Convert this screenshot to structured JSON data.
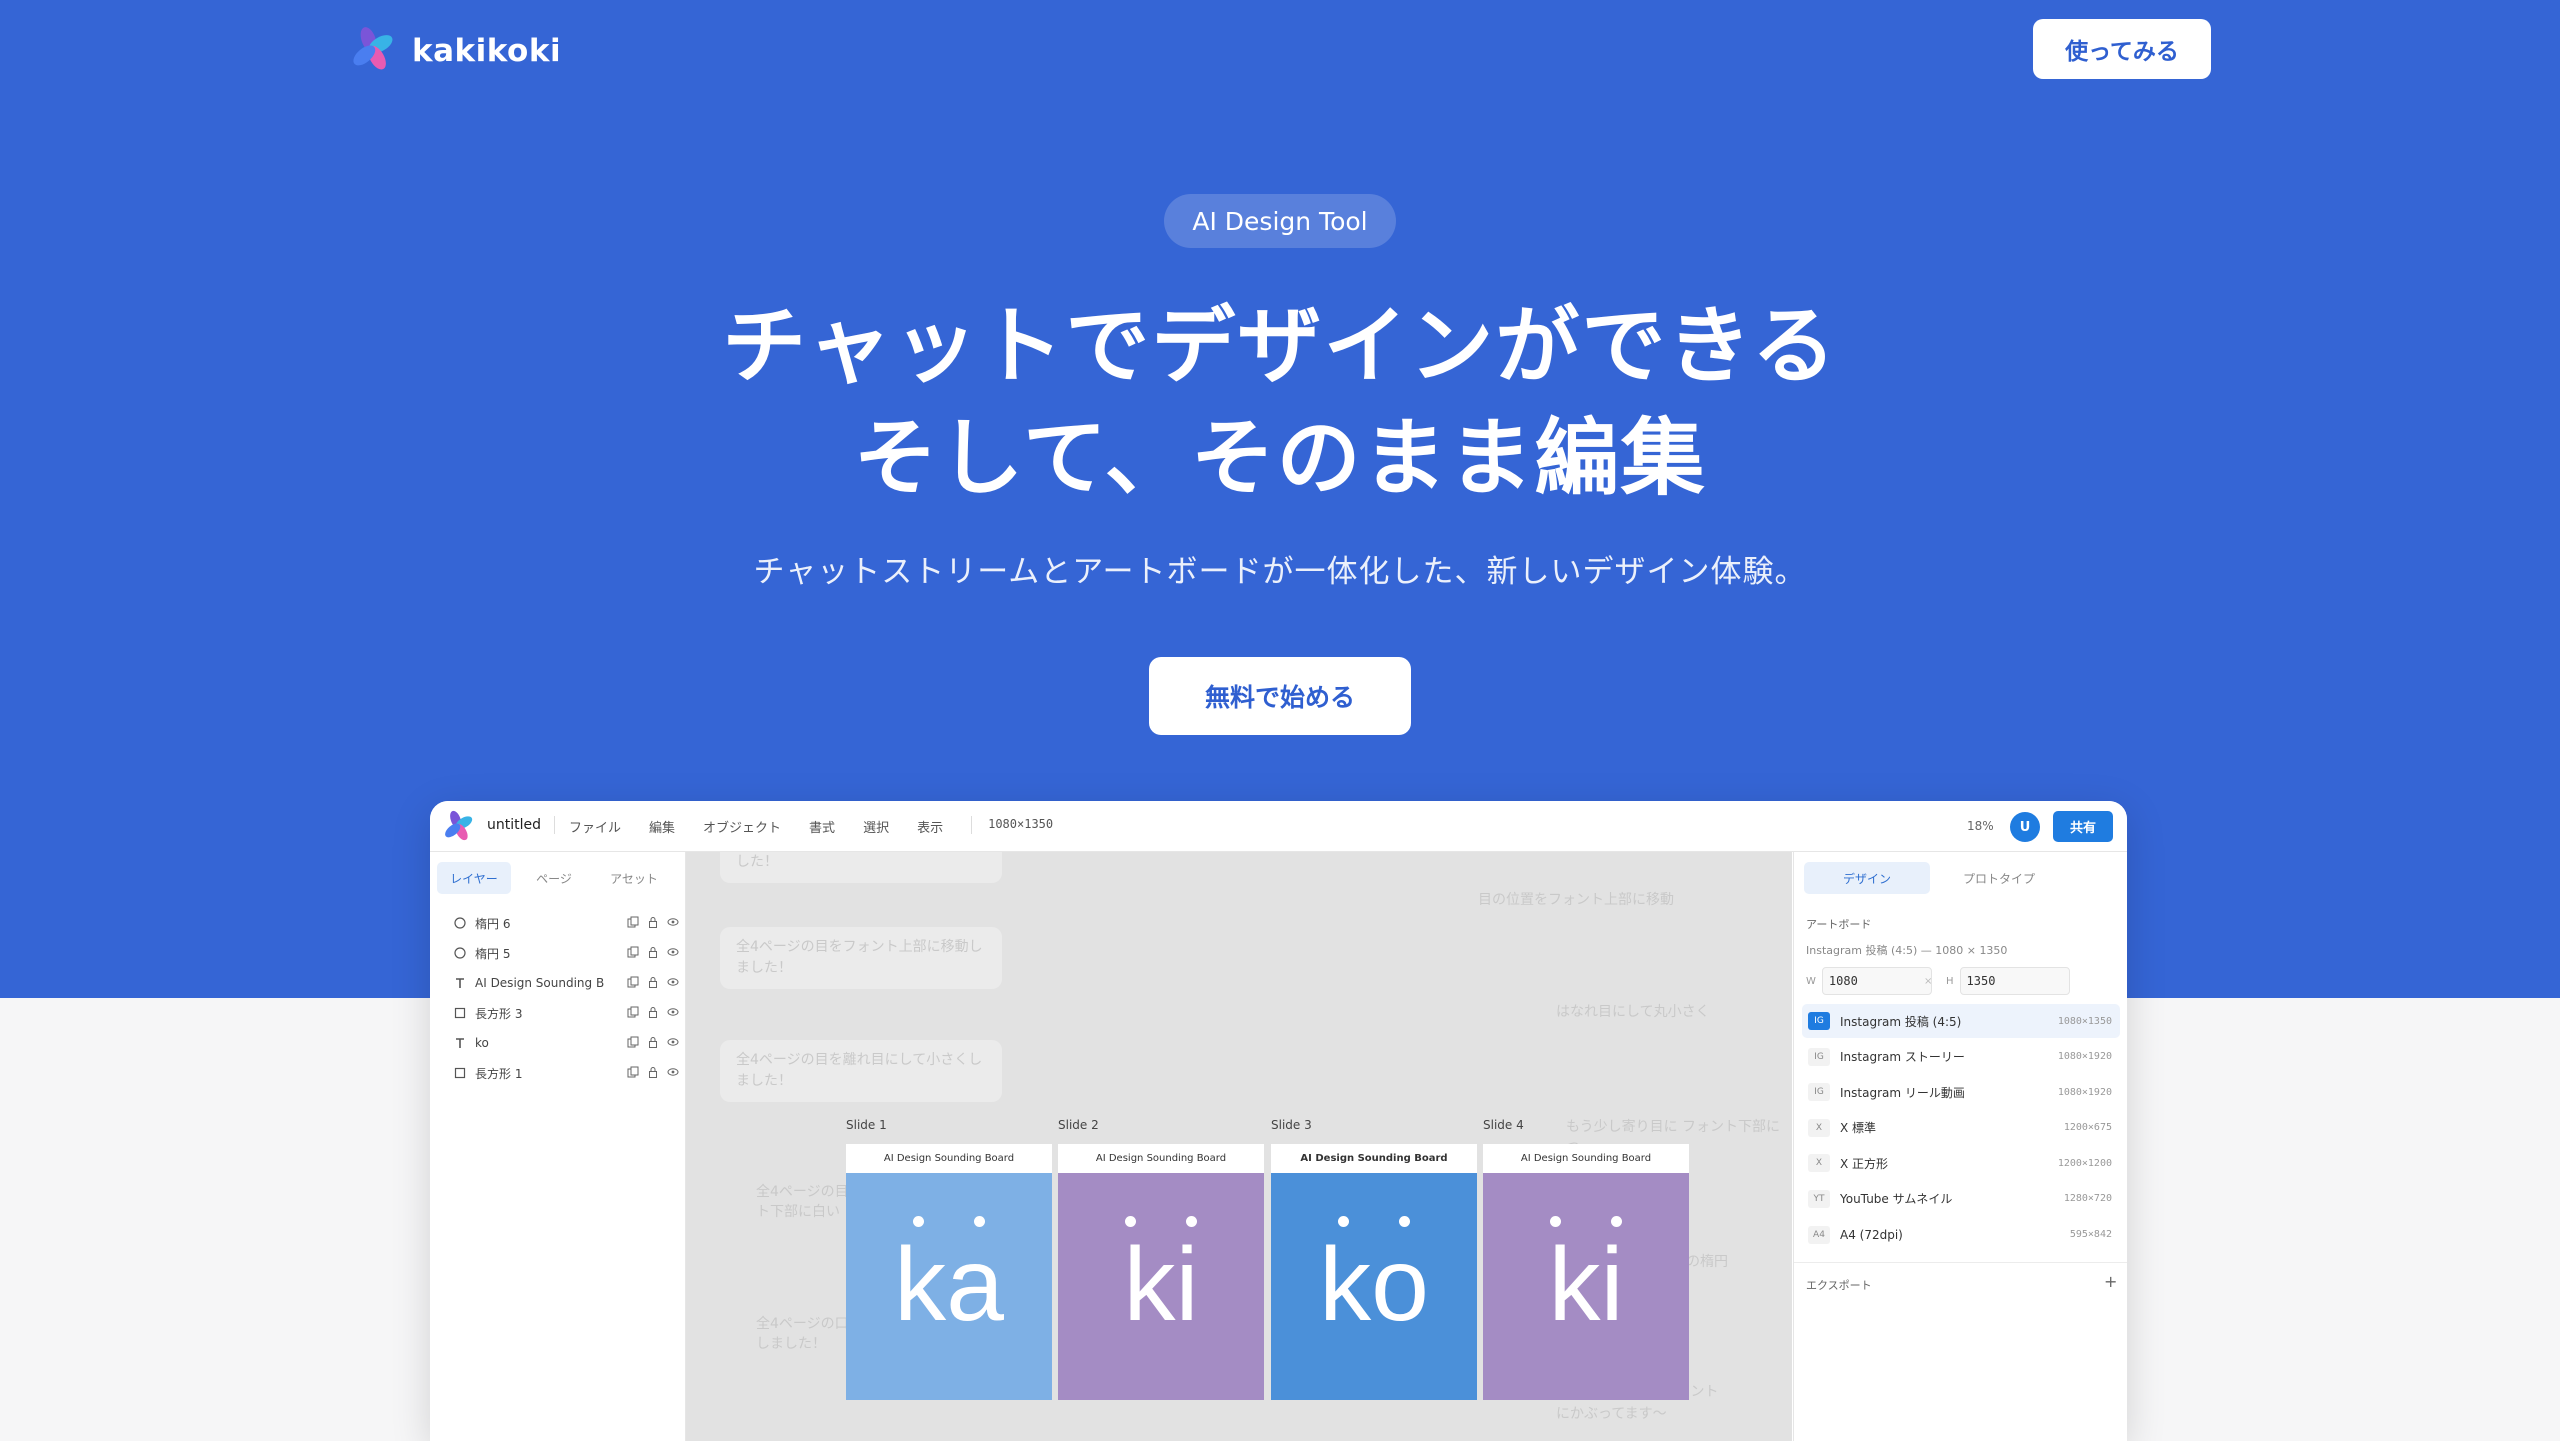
{
  "brand": {
    "name": "kakikoki"
  },
  "nav": {
    "cta": "使ってみる"
  },
  "hero": {
    "badge": "AI Design Tool",
    "headline_line1": "チャットでデザインができる",
    "headline_line2": "そして、そのまま編集",
    "subline": "チャットストリームとアートボードが一体化した、新しいデザイン体験。",
    "cta": "無料で始める"
  },
  "colors": {
    "hero_bg": "#3565d5",
    "accent": "#1f7ce0",
    "slide_light_blue": "#7eb0e5",
    "slide_purple": "#a48cc4",
    "slide_blue": "#4b90d9"
  },
  "app": {
    "doc_title": "untitled",
    "menu": [
      "ファイル",
      "編集",
      "オブジェクト",
      "書式",
      "選択",
      "表示"
    ],
    "dimensions": "1080×1350",
    "zoom": "18%",
    "avatar": "U",
    "share": "共有",
    "left_tabs": [
      "レイヤー",
      "ページ",
      "アセット"
    ],
    "layers": [
      {
        "icon": "ellipse-icon",
        "name": "楕円 6"
      },
      {
        "icon": "ellipse-icon",
        "name": "楕円 5"
      },
      {
        "icon": "text-icon",
        "name": "AI Design Sounding B"
      },
      {
        "icon": "rectangle-icon",
        "name": "長方形 3"
      },
      {
        "icon": "text-icon",
        "name": "ko"
      },
      {
        "icon": "rectangle-icon",
        "name": "長方形 1"
      }
    ],
    "chat_ghost": [
      "した！",
      "目の位置をフォント上部に移動",
      "全4ページの目をフォント上部に移動しました！",
      "はなれ目にして丸小さく",
      "全4ページの目を離れ目にして小さくしました！",
      "もう少し寄り目に フォント下部につ",
      "全4ページの目",
      "ト下部に白い",
      "さい　現型の楕円",
      "全4ページの口",
      "しました！",
      "さい〜 フォント",
      "にかぶってます〜"
    ],
    "slides": [
      {
        "label": "Slide 1",
        "header": "AI Design Sounding Board",
        "glyph": "ka",
        "color": "#7eb0e5"
      },
      {
        "label": "Slide 2",
        "header": "AI Design Sounding Board",
        "glyph": "ki",
        "color": "#a48cc4"
      },
      {
        "label": "Slide 3",
        "header": "AI Design Sounding Board",
        "glyph": "ko",
        "color": "#4b90d9"
      },
      {
        "label": "Slide 4",
        "header": "AI Design Sounding Board",
        "glyph": "ki",
        "color": "#a48cc4"
      }
    ],
    "right_tabs": [
      "デザイン",
      "プロトタイプ"
    ],
    "artboard": {
      "title": "アートボード",
      "current": "Instagram 投稿 (4:5) — 1080 × 1350",
      "w_label": "W",
      "w": "1080",
      "x_sep": "×",
      "h_label": "H",
      "h": "1350"
    },
    "presets": [
      {
        "tag": "IG",
        "name": "Instagram 投稿 (4:5)",
        "size": "1080×1350",
        "active": true
      },
      {
        "tag": "IG",
        "name": "Instagram ストーリー",
        "size": "1080×1920",
        "active": false
      },
      {
        "tag": "IG",
        "name": "Instagram リール動画",
        "size": "1080×1920",
        "active": false
      },
      {
        "tag": "X",
        "name": "X 標準",
        "size": "1200×675",
        "active": false
      },
      {
        "tag": "X",
        "name": "X 正方形",
        "size": "1200×1200",
        "active": false
      },
      {
        "tag": "YT",
        "name": "YouTube サムネイル",
        "size": "1280×720",
        "active": false
      },
      {
        "tag": "A4",
        "name": "A4 (72dpi)",
        "size": "595×842",
        "active": false
      }
    ],
    "export": "エクスポート",
    "export_add": "+"
  }
}
